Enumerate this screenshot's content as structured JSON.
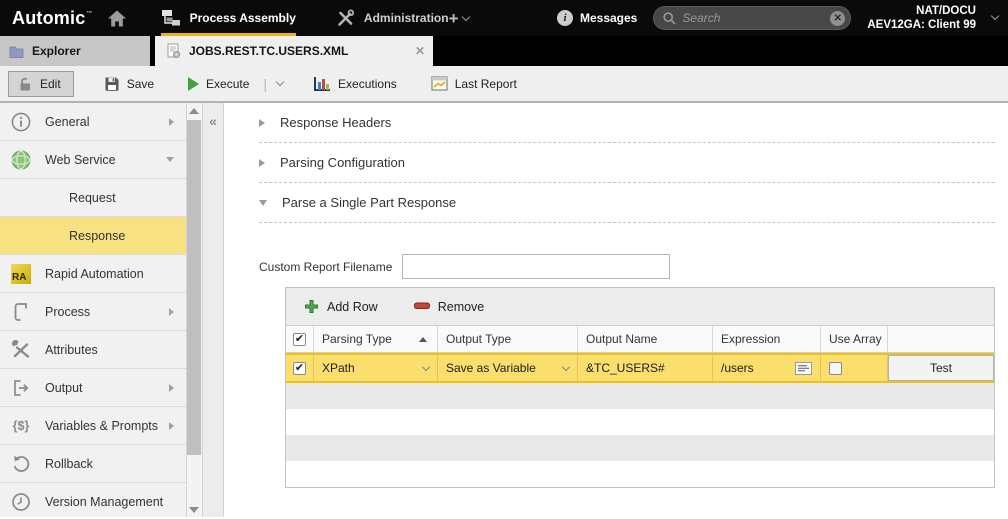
{
  "topbar": {
    "logo": "Automic",
    "nav": [
      {
        "label": "Process Assembly",
        "active": true
      },
      {
        "label": "Administration",
        "active": false
      }
    ],
    "messages_label": "Messages",
    "search_placeholder": "Search",
    "client_line1": "NAT/DOCU",
    "client_line2": "AEV12GA: Client 99"
  },
  "tabs": {
    "explorer": "Explorer",
    "document": "JOBS.REST.TC.USERS.XML"
  },
  "toolbar": {
    "edit": "Edit",
    "save": "Save",
    "execute": "Execute",
    "executions": "Executions",
    "last_report": "Last Report"
  },
  "sidebar": {
    "items": [
      {
        "label": "General"
      },
      {
        "label": "Web Service"
      },
      {
        "label": "Request"
      },
      {
        "label": "Response",
        "selected": true
      },
      {
        "label": "Rapid Automation"
      },
      {
        "label": "Process"
      },
      {
        "label": "Attributes"
      },
      {
        "label": "Output"
      },
      {
        "label": "Variables & Prompts"
      },
      {
        "label": "Rollback"
      },
      {
        "label": "Version Management"
      }
    ]
  },
  "content": {
    "sections": [
      {
        "title": "Response Headers",
        "expanded": false
      },
      {
        "title": "Parsing Configuration",
        "expanded": false
      },
      {
        "title": "Parse a Single Part Response",
        "expanded": true
      }
    ],
    "custom_report_label": "Custom Report Filename",
    "custom_report_value": "",
    "table": {
      "add_row_label": "Add Row",
      "remove_label": "Remove",
      "columns": [
        "Parsing Type",
        "Output Type",
        "Output Name",
        "Expression",
        "Use Array"
      ],
      "row": {
        "selected": true,
        "parsing_type": "XPath",
        "output_type": "Save as Variable",
        "output_name": "&TC_USERS#",
        "expression": "/users",
        "use_array": false,
        "test_label": "Test"
      }
    }
  },
  "colors": {
    "accent_gold": "#EEB211",
    "row_highlight": "#FADF6E",
    "sidebar_selection": "#F7E180"
  }
}
